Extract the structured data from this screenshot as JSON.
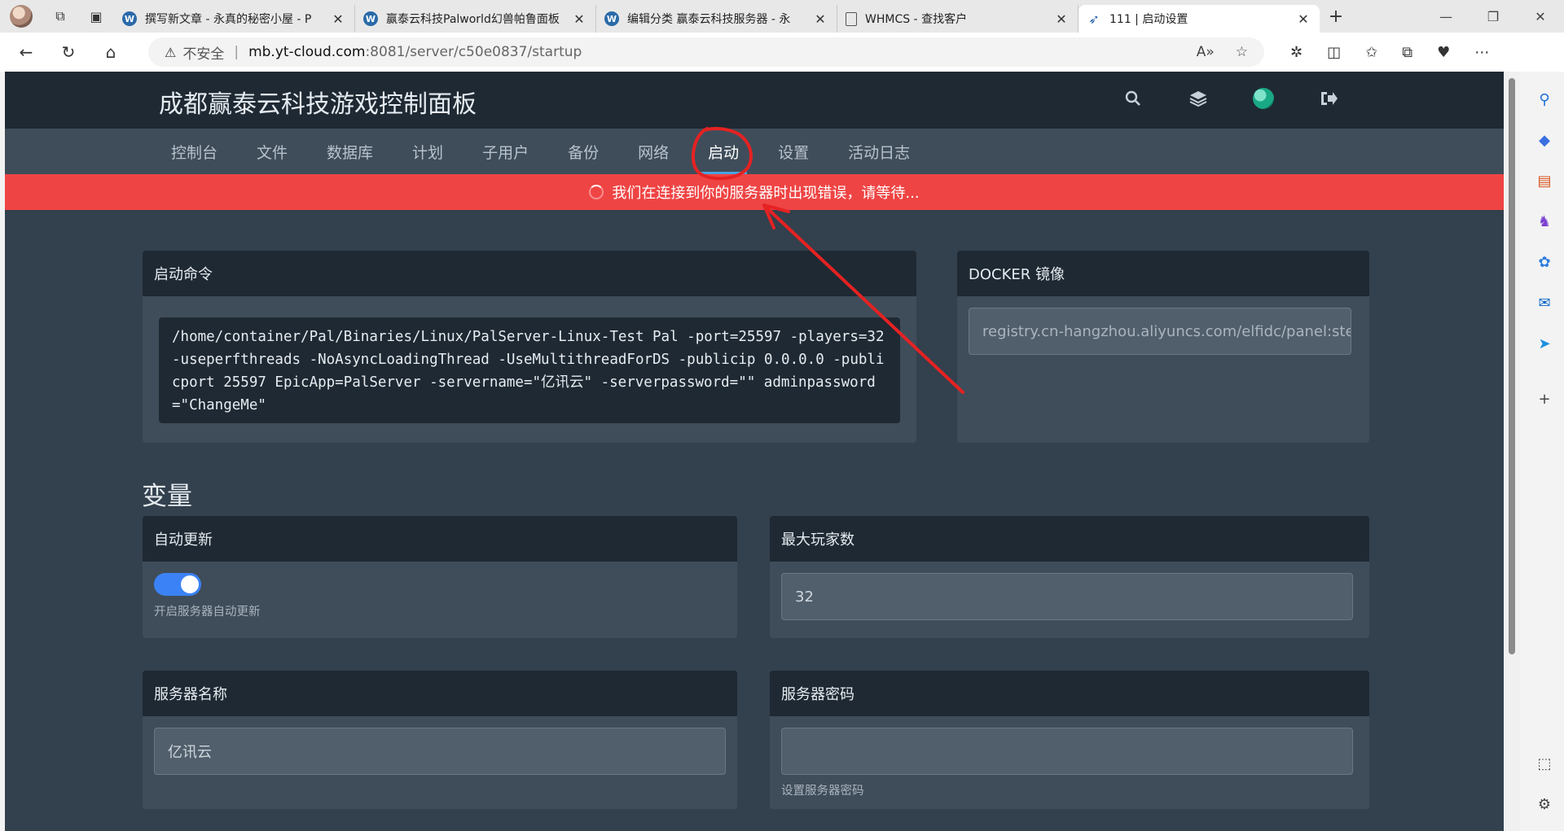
{
  "browser": {
    "tabs": [
      {
        "title": "撰写新文章 - 永真的秘密小屋 - P",
        "favicon": "wordpress-icon"
      },
      {
        "title": "赢泰云科技Palworld幻兽帕鲁面板",
        "favicon": "wordpress-icon"
      },
      {
        "title": "编辑分类 赢泰云科技服务器 - 永",
        "favicon": "wordpress-icon"
      },
      {
        "title": "WHMCS - 查找客户",
        "favicon": "document-icon"
      },
      {
        "title": "111 | 启动设置",
        "favicon": "pterodactyl-icon"
      }
    ],
    "address": {
      "insecure_label": "不安全",
      "host": "mb.yt-cloud.com",
      "rest": ":8081/server/c50e0837/startup"
    }
  },
  "panel": {
    "brand": "成都赢泰云科技游戏控制面板",
    "nav": [
      "控制台",
      "文件",
      "数据库",
      "计划",
      "子用户",
      "备份",
      "网络",
      "启动",
      "设置",
      "活动日志"
    ],
    "active_nav": "启动",
    "error_message": "我们在连接到你的服务器时出现错误，请等待..."
  },
  "startup": {
    "command_title": "启动命令",
    "command": "/home/container/Pal/Binaries/Linux/PalServer-Linux-Test Pal -port=25597 -players=32 -useperfthreads -NoAsyncLoadingThread -UseMultithreadForDS -publicip 0.0.0.0 -publicport 25597 EpicApp=PalServer -servername=\"亿讯云\" -serverpassword=\"\" adminpassword=\"ChangeMe\"",
    "docker_title": "DOCKER 镜像",
    "docker_image": "registry.cn-hangzhou.aliyuncs.com/elfidc/panel:steam"
  },
  "variables": {
    "title": "变量",
    "auto_update": {
      "title": "自动更新",
      "enabled": true,
      "helper": "开启服务器自动更新"
    },
    "max_players": {
      "title": "最大玩家数",
      "value": "32"
    },
    "server_name": {
      "title": "服务器名称",
      "value": "亿讯云"
    },
    "server_password": {
      "title": "服务器密码",
      "value": "",
      "helper": "设置服务器密码"
    }
  },
  "colors": {
    "header_bg": "#1f2933",
    "page_bg": "#33404d",
    "card_bg": "#3f4d5a",
    "error_bg": "#ef4444",
    "toggle_on": "#3b82f6",
    "annotation": "#e52222"
  }
}
